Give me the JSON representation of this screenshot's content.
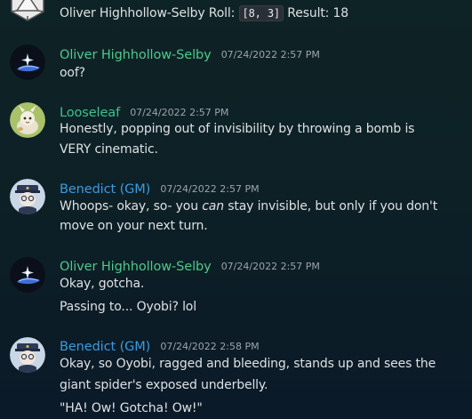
{
  "roll_line": {
    "author": "Oliver Highhollow-Selby",
    "roll_label": "Roll:",
    "roll_value": "[8, 3]",
    "result_label": "Result:",
    "result_value": "18"
  },
  "messages": [
    {
      "author": "Oliver Highhollow-Selby",
      "timestamp": "07/24/2022 2:57 PM",
      "lines": [
        "oof?"
      ]
    },
    {
      "author": "Looseleaf",
      "timestamp": "07/24/2022 2:57 PM",
      "lines": [
        "Honestly, popping out of invisibility by throwing a bomb is",
        "VERY cinematic."
      ]
    },
    {
      "author": "Benedict (GM)",
      "timestamp": "07/24/2022 2:57 PM",
      "line1_pre": "Whoops- okay, so- you ",
      "line1_em": "can",
      "line1_post": " stay invisible, but only if you don't",
      "line2": "move on your next turn."
    },
    {
      "author": "Oliver Highhollow-Selby",
      "timestamp": "07/24/2022 2:57 PM",
      "lines": [
        "Okay, gotcha.",
        "Passing to... Oyobi? lol"
      ]
    },
    {
      "author": "Benedict (GM)",
      "timestamp": "07/24/2022 2:58 PM",
      "lines": [
        "Okay, so Oyobi, ragged and bleeding, stands up and sees the",
        "giant spider's exposed underbelly.",
        "\"HA! Ow! Gotcha! Ow!\""
      ]
    }
  ],
  "colors": {
    "oliver": "#4fc98a",
    "looseleaf": "#3ec28a",
    "benedict": "#3b9be0"
  }
}
